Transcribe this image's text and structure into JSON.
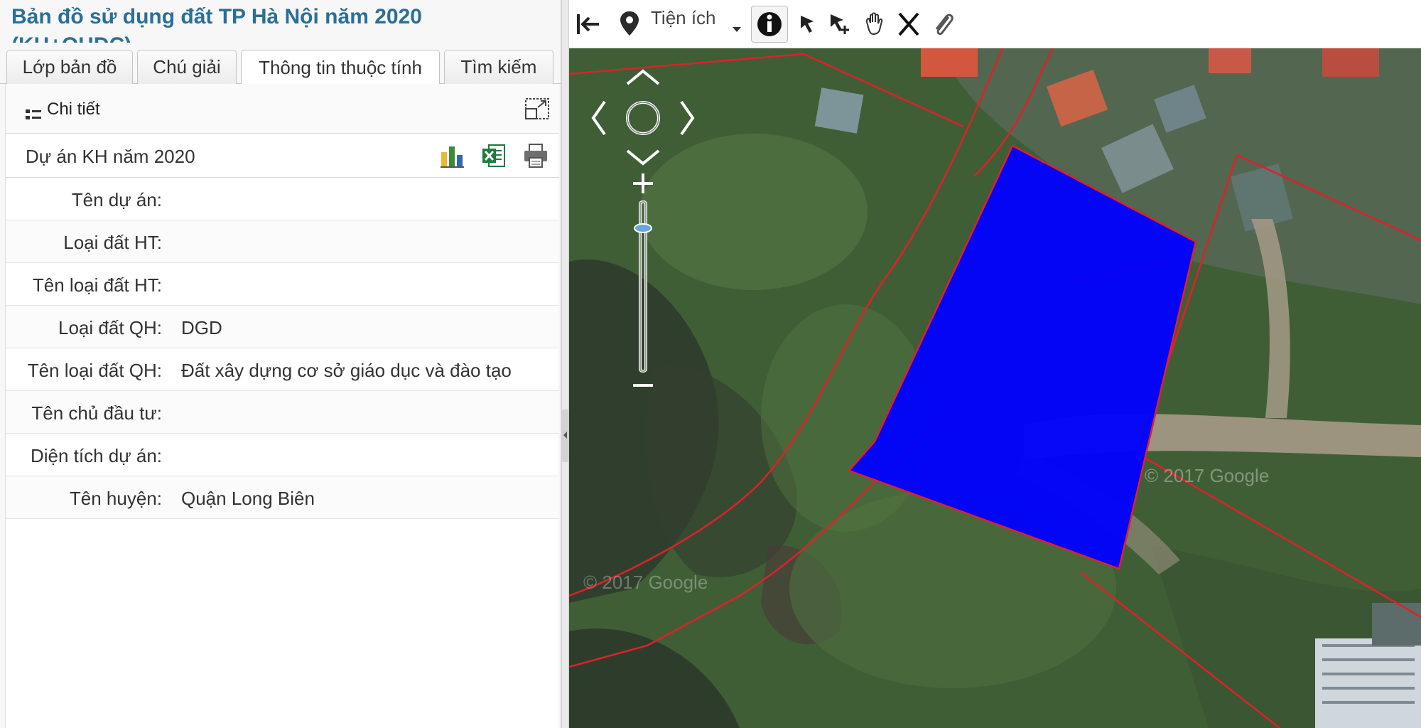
{
  "app": {
    "title": "Bản đồ sử dụng đất TP Hà Nội năm 2020",
    "title_line2": "(KH+QHDC)"
  },
  "tabs": [
    {
      "label": "Lớp bản đồ"
    },
    {
      "label": "Chú giải"
    },
    {
      "label": "Thông tin thuộc tính"
    },
    {
      "label": "Tìm kiếm"
    }
  ],
  "detail": {
    "label": "Chi tiết"
  },
  "section": {
    "title": "Dự án KH năm 2020"
  },
  "attributes": [
    {
      "label": "Tên dự án:",
      "value": ""
    },
    {
      "label": "Loại đất HT:",
      "value": ""
    },
    {
      "label": "Tên loại đất HT:",
      "value": ""
    },
    {
      "label": "Loại đất QH:",
      "value": "DGD"
    },
    {
      "label": "Tên loại đất QH:",
      "value": "Đất xây dựng cơ sở giáo dục và đào tạo"
    },
    {
      "label": "Tên chủ đầu tư:",
      "value": ""
    },
    {
      "label": "Diện tích dự án:",
      "value": ""
    },
    {
      "label": "Tên huyện:",
      "value": "Quận Long Biên"
    }
  ],
  "toolbar": {
    "utilities_label": "Tiện ích"
  },
  "map": {
    "watermark": "© 2017 Google",
    "parcel_color": "#0000ff",
    "boundary_color": "#e0202a"
  },
  "colors": {
    "title": "#2a6f97"
  }
}
